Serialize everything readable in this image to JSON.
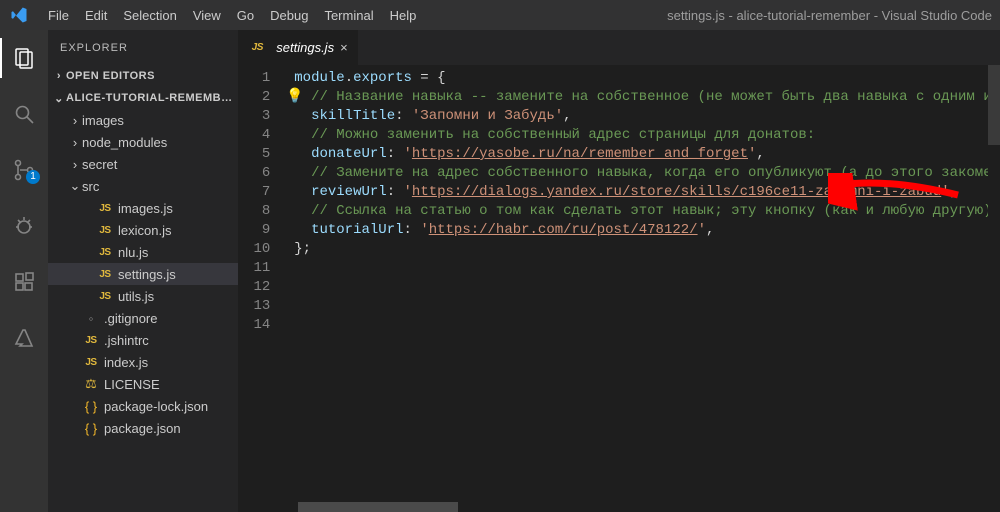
{
  "window": {
    "title": "settings.js - alice-tutorial-remember - Visual Studio Code"
  },
  "menu": [
    "File",
    "Edit",
    "Selection",
    "View",
    "Go",
    "Debug",
    "Terminal",
    "Help"
  ],
  "activitybar": {
    "source_control_badge": "1"
  },
  "sidebar": {
    "title": "EXPLORER",
    "sections": {
      "open_editors": "OPEN EDITORS",
      "project": "ALICE-TUTORIAL-REMEMB…"
    },
    "tree": [
      {
        "kind": "folder",
        "name": "images",
        "depth": 1,
        "expanded": false
      },
      {
        "kind": "folder",
        "name": "node_modules",
        "depth": 1,
        "expanded": false
      },
      {
        "kind": "folder",
        "name": "secret",
        "depth": 1,
        "expanded": false
      },
      {
        "kind": "folder",
        "name": "src",
        "depth": 1,
        "expanded": true
      },
      {
        "kind": "file",
        "name": "images.js",
        "depth": 2,
        "icon": "js"
      },
      {
        "kind": "file",
        "name": "lexicon.js",
        "depth": 2,
        "icon": "js"
      },
      {
        "kind": "file",
        "name": "nlu.js",
        "depth": 2,
        "icon": "js"
      },
      {
        "kind": "file",
        "name": "settings.js",
        "depth": 2,
        "icon": "js",
        "selected": true
      },
      {
        "kind": "file",
        "name": "utils.js",
        "depth": 2,
        "icon": "js"
      },
      {
        "kind": "file",
        "name": ".gitignore",
        "depth": 1,
        "icon": "git"
      },
      {
        "kind": "file",
        "name": ".jshintrc",
        "depth": 1,
        "icon": "js"
      },
      {
        "kind": "file",
        "name": "index.js",
        "depth": 1,
        "icon": "js"
      },
      {
        "kind": "file",
        "name": "LICENSE",
        "depth": 1,
        "icon": "license"
      },
      {
        "kind": "file",
        "name": "package-lock.json",
        "depth": 1,
        "icon": "json"
      },
      {
        "kind": "file",
        "name": "package.json",
        "depth": 1,
        "icon": "json"
      }
    ]
  },
  "tabs": [
    {
      "label": "settings.js",
      "icon": "js",
      "active": true
    }
  ],
  "code": {
    "lines": [
      [
        {
          "c": "tk-var",
          "t": "module"
        },
        {
          "c": "tk-pun",
          "t": "."
        },
        {
          "c": "tk-var",
          "t": "exports"
        },
        {
          "c": "tk-pun",
          "t": " = {"
        }
      ],
      [
        {
          "c": "",
          "t": "  "
        },
        {
          "c": "tk-cmt",
          "t": "// Название навыка -- замените на собственное (не может быть два навыка с одним им"
        }
      ],
      [
        {
          "c": "",
          "t": "  "
        },
        {
          "c": "tk-prop",
          "t": "skillTitle"
        },
        {
          "c": "tk-pun",
          "t": ": "
        },
        {
          "c": "tk-str",
          "t": "'Запомни и Забудь'"
        },
        {
          "c": "tk-pun",
          "t": ","
        }
      ],
      [
        {
          "c": "",
          "t": ""
        }
      ],
      [
        {
          "c": "",
          "t": "  "
        },
        {
          "c": "tk-cmt",
          "t": "// Можно заменить на собственный адрес страницы для донатов:"
        }
      ],
      [
        {
          "c": "",
          "t": "  "
        },
        {
          "c": "tk-prop",
          "t": "donateUrl"
        },
        {
          "c": "tk-pun",
          "t": ": "
        },
        {
          "c": "tk-str",
          "t": "'"
        },
        {
          "c": "tk-link",
          "t": "https://yasobe.ru/na/remember_and_forget"
        },
        {
          "c": "tk-str",
          "t": "'"
        },
        {
          "c": "tk-pun",
          "t": ","
        }
      ],
      [
        {
          "c": "",
          "t": ""
        }
      ],
      [
        {
          "c": "",
          "t": "  "
        },
        {
          "c": "tk-cmt",
          "t": "// Замените на адрес собственного навыка, когда его опубликуют (а до этого закомен"
        }
      ],
      [
        {
          "c": "",
          "t": "  "
        },
        {
          "c": "tk-prop",
          "t": "reviewUrl"
        },
        {
          "c": "tk-pun",
          "t": ": "
        },
        {
          "c": "tk-str",
          "t": "'"
        },
        {
          "c": "tk-link",
          "t": "https://dialogs.yandex.ru/store/skills/c196ce11-zapomni-i-zabud"
        },
        {
          "c": "tk-str",
          "t": "'"
        },
        {
          "c": "tk-pun",
          "t": ","
        }
      ],
      [
        {
          "c": "",
          "t": ""
        }
      ],
      [
        {
          "c": "",
          "t": "  "
        },
        {
          "c": "tk-cmt",
          "t": "// Ссылка на статью о том как сделать этот навык; эту кнопку (как и любую другую) "
        }
      ],
      [
        {
          "c": "",
          "t": "  "
        },
        {
          "c": "tk-prop",
          "t": "tutorialUrl"
        },
        {
          "c": "tk-pun",
          "t": ": "
        },
        {
          "c": "tk-str",
          "t": "'"
        },
        {
          "c": "tk-link",
          "t": "https://habr.com/ru/post/478122/"
        },
        {
          "c": "tk-str",
          "t": "'"
        },
        {
          "c": "tk-pun",
          "t": ","
        }
      ],
      [
        {
          "c": "tk-pun",
          "t": "};"
        }
      ],
      [
        {
          "c": "",
          "t": ""
        }
      ]
    ]
  }
}
